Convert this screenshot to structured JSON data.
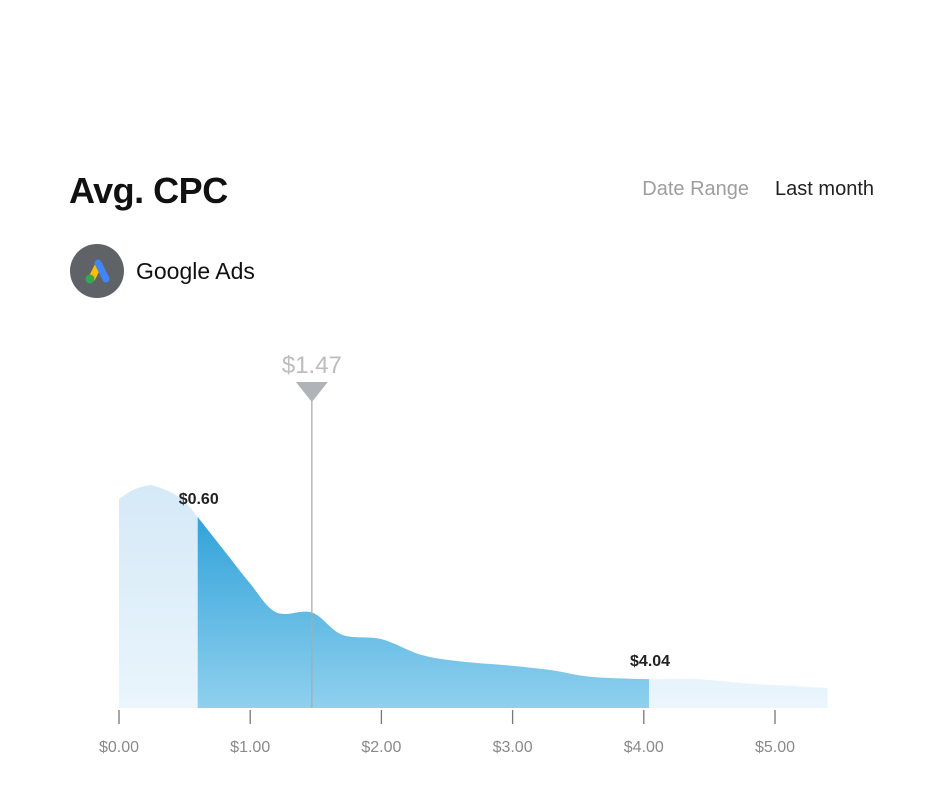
{
  "header": {
    "title": "Avg. CPC",
    "date_range_label": "Date Range",
    "date_range_value": "Last month"
  },
  "source": {
    "name": "Google Ads",
    "icon": "google-ads-logo-icon"
  },
  "colors": {
    "highlight_top": "#229bd6",
    "highlight_bottom": "#8fd0ee",
    "outer_fill": "#dcedf8",
    "marker": "#b0b4b8",
    "axis": "#777777"
  },
  "chart_data": {
    "type": "area",
    "title": "Avg. CPC",
    "xlabel": "",
    "ylabel": "",
    "x_unit": "USD",
    "xlim": [
      0,
      5.4
    ],
    "ylim": [
      0,
      1
    ],
    "grid": false,
    "x_ticks": [
      0,
      1,
      2,
      3,
      4,
      5
    ],
    "x_tick_labels": [
      "$0.00",
      "$1.00",
      "$2.00",
      "$3.00",
      "$4.00",
      "$5.00"
    ],
    "distribution": {
      "x": [
        0,
        0.1,
        0.2,
        0.27,
        0.4,
        0.5,
        0.6,
        0.8,
        1.0,
        1.2,
        1.47,
        1.7,
        2.0,
        2.3,
        2.6,
        3.0,
        3.3,
        3.6,
        4.04,
        4.4,
        4.8,
        5.1,
        5.4
      ],
      "y": [
        0.94,
        0.98,
        1.0,
        1.0,
        0.97,
        0.93,
        0.86,
        0.71,
        0.56,
        0.43,
        0.43,
        0.33,
        0.31,
        0.24,
        0.21,
        0.19,
        0.17,
        0.14,
        0.13,
        0.13,
        0.11,
        0.1,
        0.09
      ]
    },
    "highlight_range": {
      "low": 0.6,
      "high": 4.04,
      "low_label": "$0.60",
      "high_label": "$4.04"
    },
    "marker": {
      "value": 1.47,
      "label": "$1.47"
    }
  }
}
